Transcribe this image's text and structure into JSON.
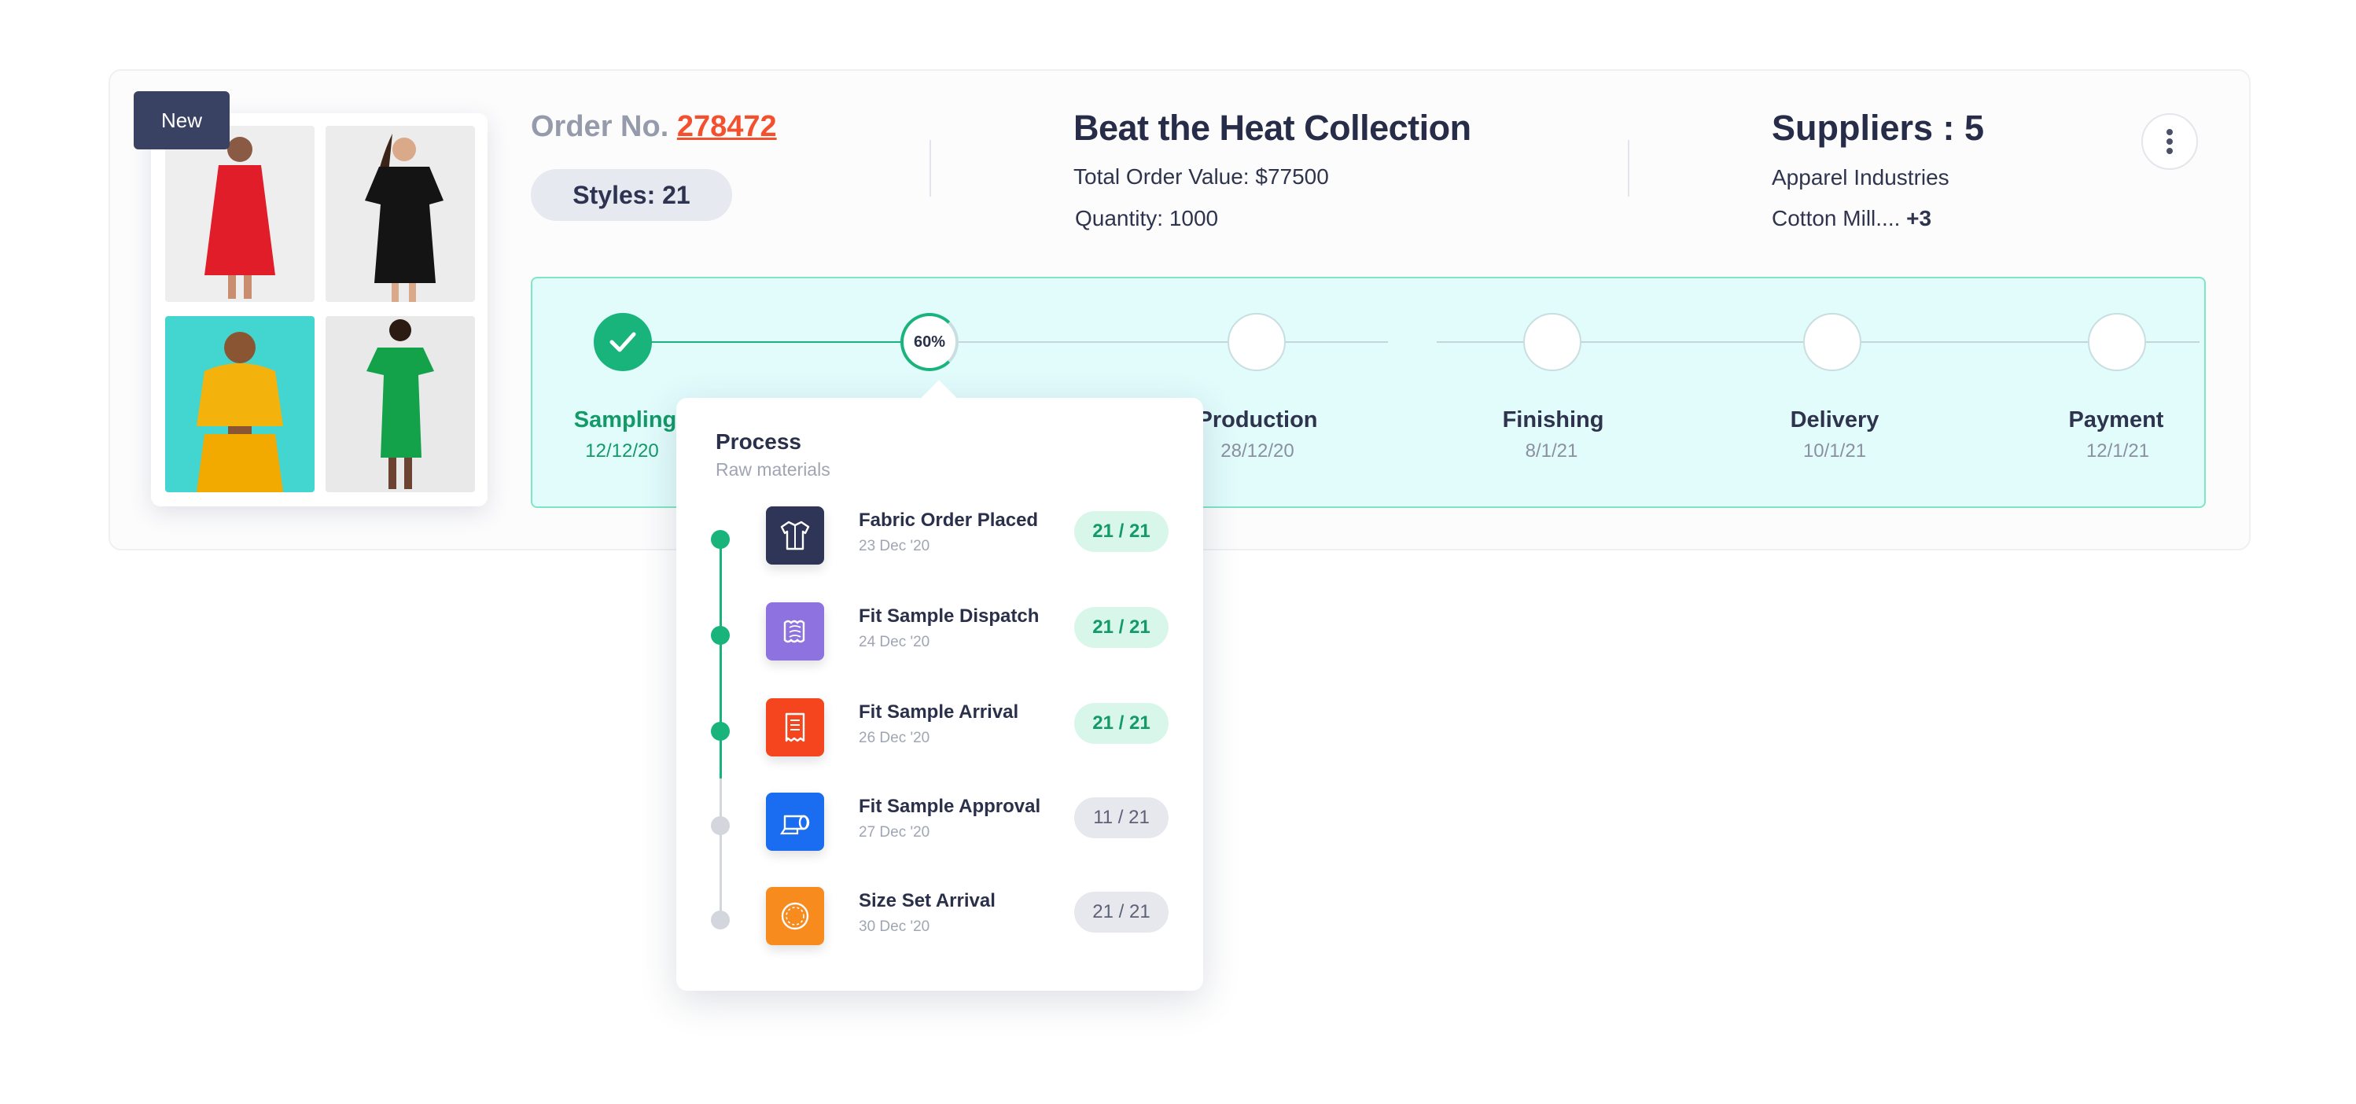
{
  "badge": "New",
  "order": {
    "label": "Order No.",
    "number": "278472",
    "styles": "Styles: 21"
  },
  "collection": {
    "title": "Beat the Heat Collection",
    "value_line": "Total Order Value:  $77500",
    "quantity_line": "Quantity: 1000"
  },
  "suppliers": {
    "title": "Suppliers : 5",
    "line1": "Apparel Industries",
    "line2": "Cotton Mill....",
    "more": "+3"
  },
  "progress": {
    "active_percent_label": "60%",
    "active_fraction": 0.6,
    "stages": [
      {
        "label": "Sampling",
        "date": "12/12/20",
        "status": "done"
      },
      {
        "label": "Process",
        "date": "",
        "status": "active"
      },
      {
        "label": "Production",
        "date": "28/12/20",
        "status": "pending"
      },
      {
        "label": "Finishing",
        "date": "8/1/21",
        "status": "pending"
      },
      {
        "label": "Delivery",
        "date": "10/1/21",
        "status": "pending"
      },
      {
        "label": "Payment",
        "date": "12/1/21",
        "status": "pending"
      }
    ]
  },
  "popover": {
    "title": "Process",
    "subtitle": "Raw materials",
    "steps": [
      {
        "name": "Fabric Order Placed",
        "date": "23 Dec '20",
        "count": "21 / 21",
        "status": "done",
        "icon": "shirt-icon",
        "color": "#2e3556"
      },
      {
        "name": "Fit Sample Dispatch",
        "date": "24 Dec '20",
        "count": "21 / 21",
        "status": "done",
        "icon": "fabric-swatch-icon",
        "color": "#8e72e0"
      },
      {
        "name": "Fit Sample Arrival",
        "date": "26 Dec '20",
        "count": "21 / 21",
        "status": "done",
        "icon": "receipt-icon",
        "color": "#f4451f"
      },
      {
        "name": "Fit Sample Approval",
        "date": "27 Dec '20",
        "count": "11 / 21",
        "status": "pending",
        "icon": "fabric-roll-icon",
        "color": "#1a6cf0"
      },
      {
        "name": "Size Set Arrival",
        "date": "30 Dec '20",
        "count": "21 / 21",
        "status": "pending",
        "icon": "button-icon",
        "color": "#f78b1e"
      }
    ]
  },
  "colors": {
    "accent": "#18b47b",
    "alert": "#f4502e",
    "tracker_bg": "#e2fcfc"
  }
}
